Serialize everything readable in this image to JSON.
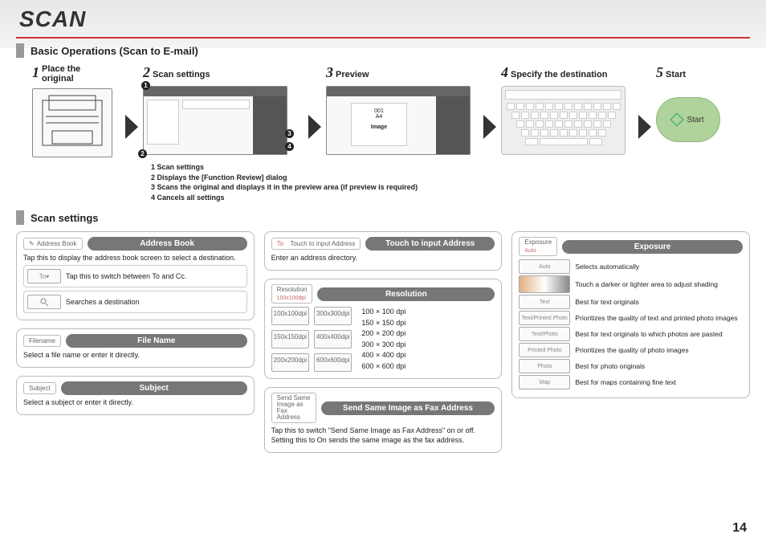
{
  "page_title": "SCAN",
  "page_number": "14",
  "section_basic": "Basic Operations (Scan to E-mail)",
  "section_settings": "Scan settings",
  "steps": {
    "s1": {
      "num": "1",
      "label": "Place the\noriginal"
    },
    "s2": {
      "num": "2",
      "label": "Scan settings"
    },
    "s3": {
      "num": "3",
      "label": "Preview"
    },
    "s4": {
      "num": "4",
      "label": "Specify the destination"
    },
    "s5": {
      "num": "5",
      "label": "Start"
    }
  },
  "start_button": "Start",
  "preview_text": {
    "l1": "001",
    "l2": "A4",
    "l3": "Image"
  },
  "footnotes": {
    "f1": "1 Scan settings",
    "f2": "2 Displays the [Function Review] dialog",
    "f3": "3 Scans the original and displays it in the preview area (if preview is required)",
    "f4": "4 Cancels all settings"
  },
  "address_book": {
    "chip": "Address Book",
    "title": "Address Book",
    "desc": "Tap this to display the address book screen to select a destination.",
    "row1_icon": "To",
    "row1_text": "Tap this to switch between To and Cc.",
    "row2_text": "Searches a destination"
  },
  "file_name": {
    "chip": "Filename",
    "title": "File Name",
    "desc": "Select a file name or enter it directly."
  },
  "subject": {
    "chip": "Subject",
    "title": "Subject",
    "desc": "Select a subject or enter it directly."
  },
  "touch_input": {
    "chip": "Touch to input Address",
    "title": "Touch to input Address",
    "desc": "Enter an address directory."
  },
  "resolution": {
    "chip": "Resolution",
    "chip2": "100x100dpi",
    "title": "Resolution",
    "buttons": [
      "100x100dpi",
      "300x300dpi",
      "150x150dpi",
      "400x400dpi",
      "200x200dpi",
      "600x600dpi"
    ],
    "list": [
      "100 × 100 dpi",
      "150 × 150 dpi",
      "200 × 200 dpi",
      "300 × 300 dpi",
      "400 × 400 dpi",
      "600 × 600 dpi"
    ]
  },
  "send_fax": {
    "chip": "Send Same Image as Fax Address",
    "title": "Send Same Image as Fax Address",
    "desc1": "Tap this to switch \"Send Same Image as Fax Address\" on or off.",
    "desc2": "Setting this to On sends the same image as the fax address."
  },
  "exposure": {
    "chip": "Exposure",
    "chip2": "Auto",
    "title": "Exposure",
    "rows": [
      {
        "icon": "Auto",
        "text": "Selects automatically"
      },
      {
        "icon": "",
        "text": "Touch a darker or lighter area to adjust shading"
      },
      {
        "icon": "Text",
        "text": "Best for text originals"
      },
      {
        "icon": "Text/Printed Photo",
        "text": "Prioritizes the quality of text and printed photo images"
      },
      {
        "icon": "Text/Photo",
        "text": "Best for text originals to which photos are pasted"
      },
      {
        "icon": "Printed Photo",
        "text": "Prioritizes the quality of photo images"
      },
      {
        "icon": "Photo",
        "text": "Best for photo originals"
      },
      {
        "icon": "Map",
        "text": "Best for maps containing fine text"
      }
    ]
  }
}
